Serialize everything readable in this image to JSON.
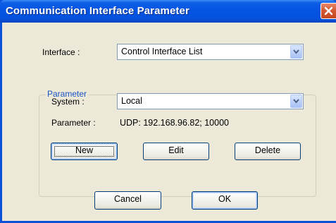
{
  "window": {
    "title": "Communication Interface Parameter",
    "close_icon": "close-icon"
  },
  "interface": {
    "label": "Interface :",
    "selected": "Control Interface List"
  },
  "parameter_group": {
    "title": "Parameter",
    "system_label": "System :",
    "system_selected": "Local",
    "parameter_label": "Parameter :",
    "parameter_value": "UDP: 192.168.96.82; 10000"
  },
  "buttons": {
    "new": "New",
    "edit": "Edit",
    "delete": "Delete",
    "cancel": "Cancel",
    "ok": "OK"
  },
  "colors": {
    "titlebar": "#0554e3",
    "dialog_bg": "#ece9d8",
    "group_title": "#1a53c4",
    "close_button": "#d45a34"
  }
}
